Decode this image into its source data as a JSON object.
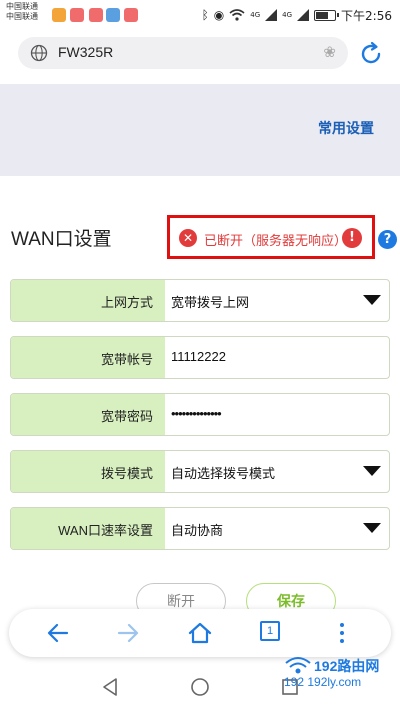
{
  "status_bar": {
    "carrier_1": "中国联通",
    "carrier_2": "中国联通",
    "network_1": "4G",
    "network_2": "4G",
    "time": "下午2:56"
  },
  "url_bar": {
    "url": "FW325R"
  },
  "header": {
    "common_settings": "常用设置"
  },
  "wan": {
    "title": "WAN口设置",
    "status": "已断开（服务器无响应）",
    "alert_glyph": "!",
    "help_glyph": "?"
  },
  "form": {
    "rows": [
      {
        "label": "上网方式",
        "value": "宽带拨号上网",
        "dropdown": true
      },
      {
        "label": "宽带帐号",
        "value": "11112222",
        "dropdown": false
      },
      {
        "label": "宽带密码",
        "value": "••••••••••••••",
        "dropdown": false
      },
      {
        "label": "拨号模式",
        "value": "自动选择拨号模式",
        "dropdown": true
      },
      {
        "label": "WAN口速率设置",
        "value": "自动协商",
        "dropdown": true
      }
    ]
  },
  "buttons": {
    "disconnect": "断开",
    "save": "保存"
  },
  "browser_nav": {
    "tab_count": "1"
  },
  "watermark": {
    "main": "192路由网",
    "sub": "192   192ly.com"
  },
  "colors": {
    "accent_blue": "#1e7ae0",
    "link_blue": "#1b5fb6",
    "error_red": "#e23b3b",
    "box_red": "#e01010",
    "label_green": "#d8f0c0",
    "save_green": "#7cbc2a",
    "band_grey": "#e9eaf2"
  },
  "icons": [
    "globe-icon",
    "paw-icon",
    "refresh-icon",
    "error-x-icon",
    "alert-icon",
    "help-icon",
    "dropdown-caret-icon",
    "back-arrow-icon",
    "forward-arrow-icon",
    "home-icon",
    "tabs-icon",
    "more-icon",
    "android-back-icon",
    "android-home-icon",
    "android-recents-icon",
    "bluetooth-icon",
    "eye-icon",
    "wifi-icon",
    "signal-icon",
    "battery-icon"
  ]
}
